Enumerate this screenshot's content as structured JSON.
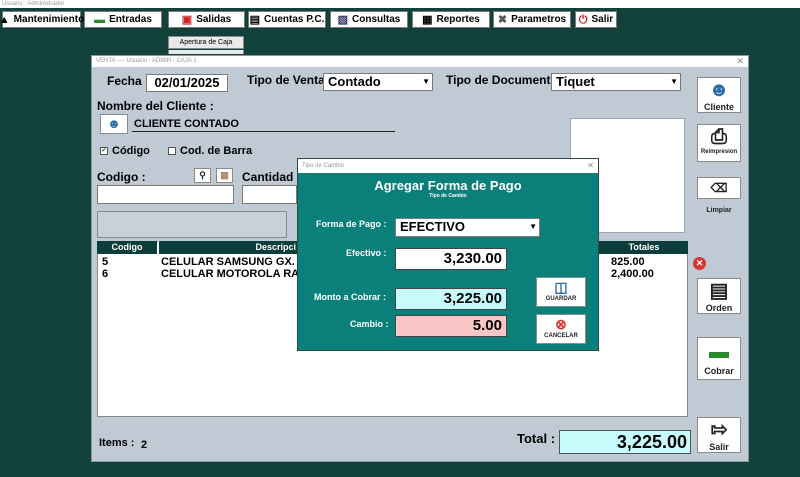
{
  "app": {
    "top_title": "Usuario : Administrador"
  },
  "menu": [
    {
      "label": "Mantenimiento",
      "icon": "user-icon"
    },
    {
      "label": "Entradas",
      "icon": "cash-icon"
    },
    {
      "label": "Salidas",
      "icon": "cart-icon"
    },
    {
      "label": "Cuentas P.C.",
      "icon": "document-icon"
    },
    {
      "label": "Consultas",
      "icon": "search-icon"
    },
    {
      "label": "Reportes",
      "icon": "report-icon"
    },
    {
      "label": "Parametros",
      "icon": "tools-icon"
    },
    {
      "label": "Salir",
      "icon": "power-icon"
    }
  ],
  "submenu": {
    "item": "Apertura de Caja"
  },
  "window": {
    "title": "VENTA  ----  Usuario : ADMIN - CAJA 1",
    "fecha_label": "Fecha :",
    "fecha_value": "02/01/2025",
    "tipo_venta_label": "Tipo de Venta :",
    "tipo_venta_value": "Contado",
    "tipo_doc_label": "Tipo de Documento :",
    "tipo_doc_value": "Tiquet",
    "cliente_label": "Nombre del Cliente :",
    "cliente_value": "CLIENTE CONTADO",
    "radio_codigo": "Código",
    "radio_codbarra": "Cod. de Barra",
    "codigo_label": "Codigo :",
    "cantidad_label": "Cantidad :",
    "table_headers": {
      "codigo": "Codigo",
      "descripcion": "Descripci",
      "totales": "Totales"
    },
    "rows": [
      {
        "codigo": "5",
        "descripcion": "CELULAR SAMSUNG GX.",
        "total": "825.00"
      },
      {
        "codigo": "6",
        "descripcion": "CELULAR MOTOROLA RA",
        "total": "2,400.00"
      }
    ],
    "items_label": "Items :",
    "items_value": "2",
    "total_label": "Total :",
    "total_value": "3,225.00",
    "buttons": {
      "cliente": "Cliente",
      "reimpresion": "Reimpresion",
      "limpiar": "Limpiar",
      "orden": "Orden",
      "cobrar": "Cobrar",
      "salir": "Salir"
    }
  },
  "dialog": {
    "title": "Tipo de Cambio",
    "heading": "Agregar Forma de Pago",
    "subheading": "Tipo de Cambio",
    "forma_label": "Forma de Pago :",
    "forma_value": "EFECTIVO",
    "efectivo_label": "Efectivo :",
    "efectivo_value": "3,230.00",
    "monto_label": "Monto a Cobrar :",
    "monto_value": "3,225.00",
    "cambio_label": "Cambio :",
    "cambio_value": "5.00",
    "guardar": "GUARDAR",
    "cancelar": "CANCELAR"
  },
  "colors": {
    "background": "#12413b",
    "dialog": "#0b7f79",
    "monto_bg": "#c8fcfc",
    "cambio_bg": "#fbc6c6"
  }
}
